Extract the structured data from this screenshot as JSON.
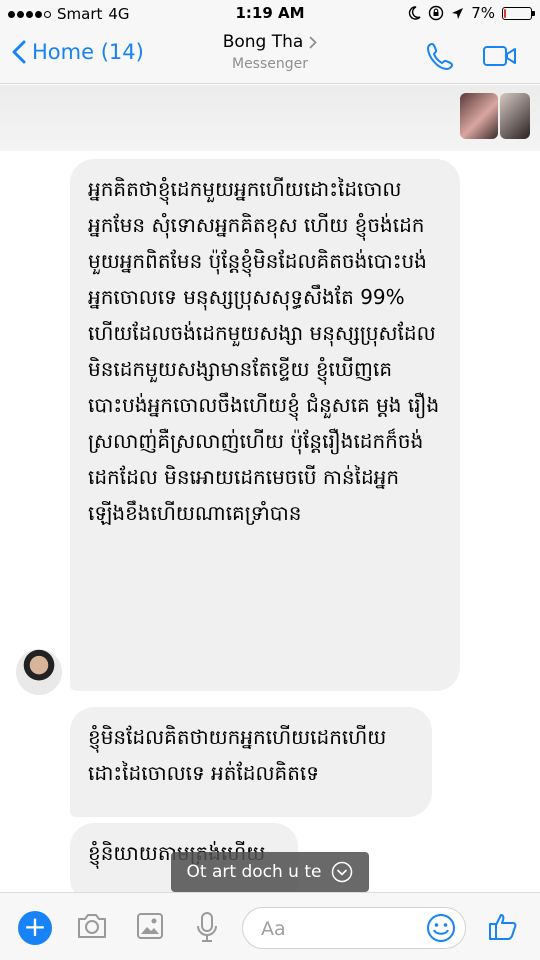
{
  "status": {
    "carrier": "Smart",
    "network": "4G",
    "time": "1:19 AM",
    "battery": "7%",
    "battery_level": 0.07
  },
  "nav": {
    "back_label": "Home (14)",
    "title": "Bong Tha",
    "subtitle": "Messenger"
  },
  "messages": [
    "អ្នកគិតថាខ្ញុំដេកមួយអ្នកហើយដោះដៃចោល អ្នកមែន សុំទោសអ្នកគិតខុស ហើយ ខ្ញុំចង់ដេកមួយអ្នកពិតមែន ប៉ុន្តែខ្ញុំមិនដែលគិតចង់បោះបង់អ្នកចោលទេ មនុស្សប្រុសសុទ្ធសឹងតែ 99% ហើយដែលចង់ដេកមួយសង្សា មនុស្សប្រុសដែលមិនដេកមួយសង្សាមានតែខ្ទើយ ខ្ញុំឃើញគេបោះបង់អ្នកចោលចឹងហើយខ្ញុំ ជំនួសគេ ម្តង រឿងស្រលាញ់គឺស្រលាញ់ហើយ ប៉ុន្តែរឿងដេកក៏ចង់ដេកដែល មិនអោយដេកមេចបើ កាន់ដៃអ្នកឡើងខឹងហើយណាគេទ្រាំបាន",
    "ខ្ញុំមិនដែលគិតថាយកអ្នកហើយដេកហើយដោះដៃចោលទេ អត់ដែលគិតទេ",
    "ខ្ញុំនិយាយតាមត្រង់ហើយ"
  ],
  "toast": {
    "text": "Ot art doch u te"
  },
  "composer": {
    "placeholder": "Aa"
  },
  "colors": {
    "accent": "#1783f7",
    "bubble": "#f1f0f0",
    "battery_low": "#e0352b"
  },
  "icons": [
    "phone-icon",
    "video-camera-icon",
    "camera-icon",
    "image-icon",
    "microphone-icon",
    "emoji-icon",
    "thumbs-up-icon"
  ]
}
